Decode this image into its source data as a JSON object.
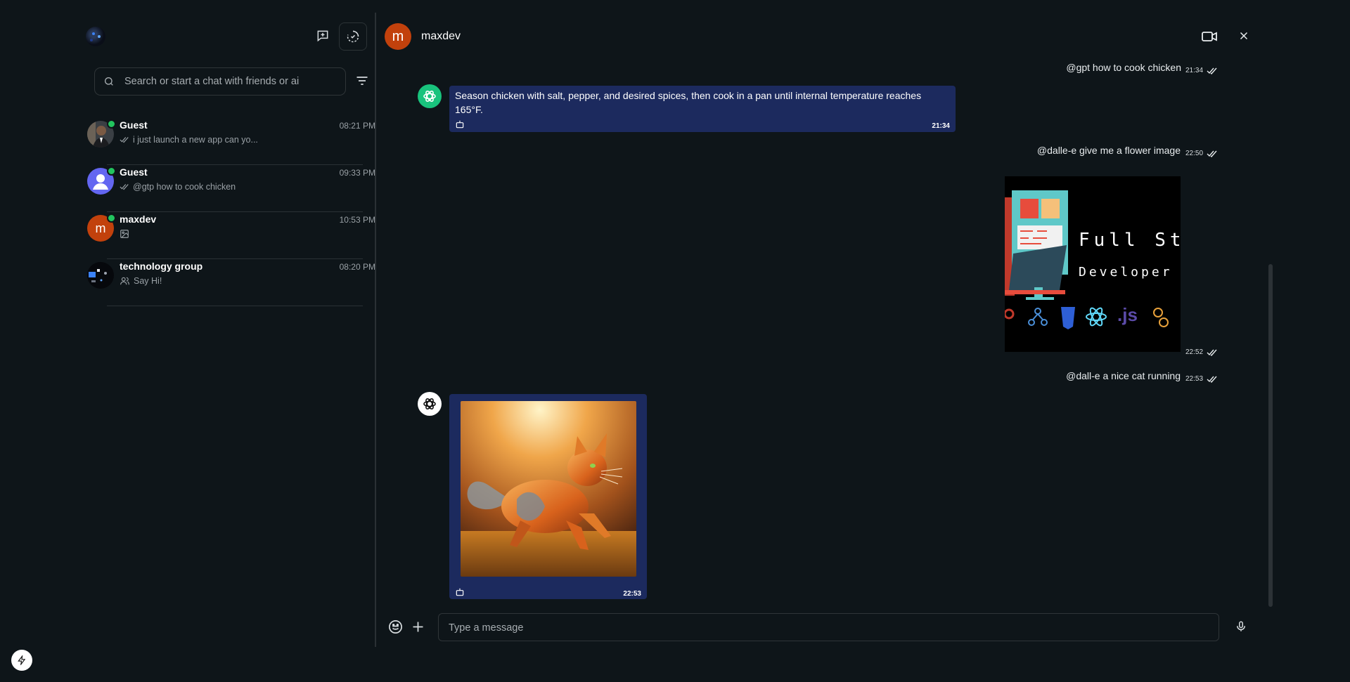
{
  "sidebar": {
    "search": {
      "placeholder": "Search or start a chat with friends or ai"
    },
    "chats": [
      {
        "name": "Guest",
        "time": "08:21 PM",
        "preview": "i just launch a new app can yo...",
        "online": true
      },
      {
        "name": "Guest",
        "time": "09:33 PM",
        "preview": "@gtp how to cook chicken",
        "online": true
      },
      {
        "name": "maxdev",
        "time": "10:53 PM",
        "avatar_letter": "m",
        "online": true
      },
      {
        "name": "technology group",
        "time": "08:20 PM",
        "preview": "Say Hi!"
      }
    ]
  },
  "chat": {
    "contact_name": "maxdev",
    "contact_initial": "m",
    "messages": [
      {
        "text": "@gpt how to cook chicken",
        "time": "21:34"
      },
      {
        "text": "Season chicken with salt, pepper, and desired spices, then cook in a pan until internal temperature reaches 165°F.",
        "time": "21:34"
      },
      {
        "text": "@dalle-e give me a flower image",
        "time": "22:50"
      },
      {
        "image_text_1": "Full Sta",
        "image_text_2": "Developer S",
        "image_js": ".js",
        "time": "22:52"
      },
      {
        "text": "@dall-e a nice cat running",
        "time": "22:53"
      },
      {
        "time": "22:53"
      }
    ]
  },
  "composer": {
    "placeholder": "Type a message"
  },
  "colors": {
    "accent_bubble": "#1c2a5e",
    "background": "#0e1519",
    "online": "#22c55e",
    "avatar_maxdev": "#c2410c"
  }
}
